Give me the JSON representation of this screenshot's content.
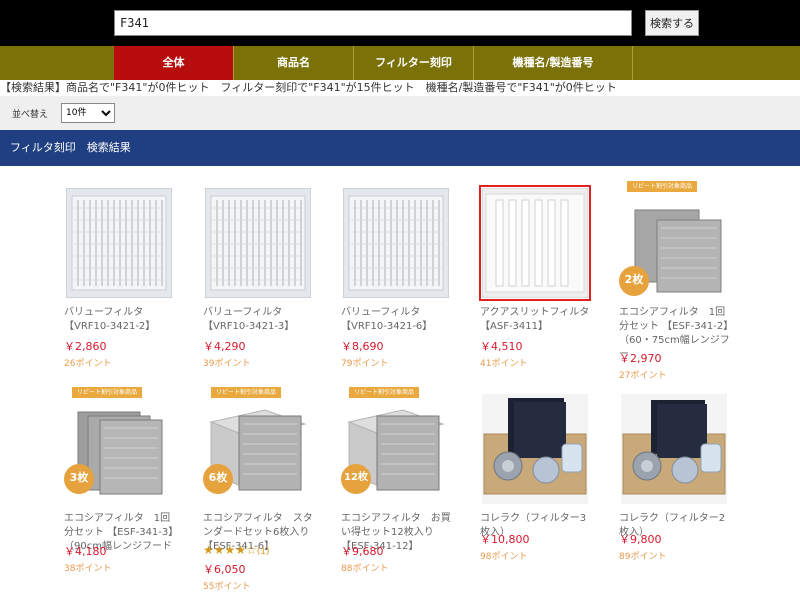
{
  "search": {
    "value": "F341",
    "button_label": "検索する"
  },
  "nav": {
    "tabs": [
      "全体",
      "商品名",
      "フィルター刻印",
      "機種名/製造番号"
    ],
    "active_index": 0
  },
  "result_summary": "【検索結果】商品名で\"F341\"が0件ヒット　フィルター刻印で\"F341\"が15件ヒット　機種名/製造番号で\"F341\"が0件ヒット",
  "sort": {
    "label": "並べ替え",
    "selected": "10件"
  },
  "section_title": "フィルタ刻印　検索結果",
  "products": [
    {
      "name": "バリューフィルタ【VRF10-3421-2】",
      "price": "￥2,860",
      "points": "26ポイント",
      "image": "grille-filter-image"
    },
    {
      "name": "バリューフィルタ【VRF10-3421-3】",
      "price": "￥4,290",
      "points": "39ポイント",
      "image": "grille-filter-image"
    },
    {
      "name": "バリューフィルタ【VRF10-3421-6】",
      "price": "￥8,690",
      "points": "79ポイント",
      "image": "grille-filter-image"
    },
    {
      "name": "アクアスリットフィルタ【ASF-3411】",
      "price": "￥4,510",
      "points": "41ポイント",
      "image": "slit-filter-image"
    },
    {
      "name": "エコシアフィルタ　1回分セット 【ESF-341-2】（60・75cm幅レンジフー",
      "price": "￥2,970",
      "points": "27ポイント",
      "badge": "リピート割引対象商品",
      "count": "2枚",
      "image": "eco-filter-image"
    },
    {
      "name": "エコシアフィルタ　1回分セット 【ESF-341-3】（90cm幅レンジフード",
      "price": "￥4,180",
      "points": "38ポイント",
      "badge": "リピート割引対象商品",
      "count": "3枚",
      "image": "eco-filter-image"
    },
    {
      "name": "エコシアフィルタ　スタンダードセット6枚入り【ESF-341-6】",
      "price": "￥6,050",
      "points": "55ポイント",
      "badge": "リピート割引対象商品",
      "count": "6枚",
      "rating": 4,
      "review_count": "(1)",
      "image": "eco-filter-box-image"
    },
    {
      "name": "エコシアフィルタ　お買い得セット12枚入り【ESF-341-12】",
      "price": "￥9,680",
      "points": "88ポイント",
      "badge": "リピート割引対象商品",
      "count": "12枚",
      "image": "eco-filter-box-image"
    },
    {
      "name": "コレラク（フィルター3枚入）",
      "price": "￥10,800",
      "points": "98ポイント",
      "image": "correlaku-kit-image"
    },
    {
      "name": "コレラク（フィルター2枚入）",
      "price": "￥9,800",
      "points": "89ポイント",
      "image": "correlaku-kit-image"
    }
  ],
  "colors": {
    "header_bg": "#000000",
    "nav_bg": "#7a7109",
    "nav_active": "#b80d0d",
    "section_bg": "#1f3f82",
    "price": "#d8182c",
    "points": "#e89a4c",
    "badge": "#e9a93e"
  }
}
